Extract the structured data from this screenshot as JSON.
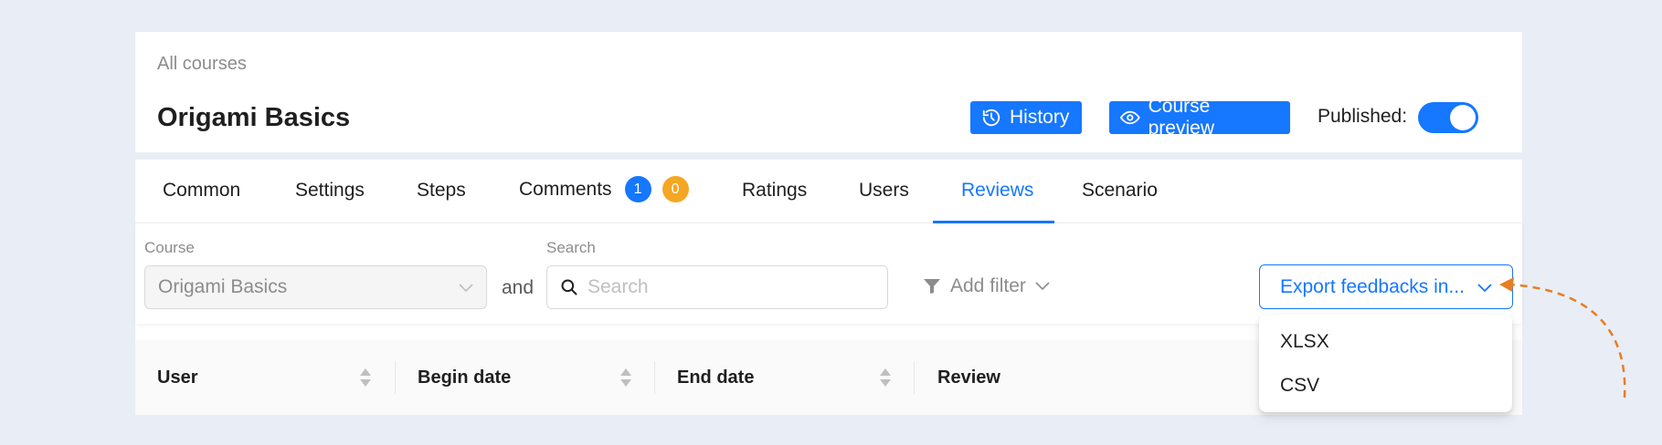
{
  "header": {
    "breadcrumb": "All courses",
    "title": "Origami Basics",
    "history_label": "History",
    "preview_label": "Course preview",
    "published_label": "Published",
    "published_separator": ":",
    "published_on": true
  },
  "tabs": [
    {
      "label": "Common"
    },
    {
      "label": "Settings"
    },
    {
      "label": "Steps"
    },
    {
      "label": "Comments",
      "badges": [
        "1",
        "0"
      ]
    },
    {
      "label": "Ratings"
    },
    {
      "label": "Users"
    },
    {
      "label": "Reviews",
      "active": true
    },
    {
      "label": "Scenario"
    }
  ],
  "filters": {
    "course_label": "Course",
    "course_value": "Origami Basics",
    "and_text": "and",
    "search_label": "Search",
    "search_placeholder": "Search",
    "add_filter_label": "Add filter",
    "export_label": "Export feedbacks in..."
  },
  "table": {
    "columns": [
      "User",
      "Begin date",
      "End date",
      "Review"
    ]
  },
  "export_menu": {
    "options": [
      "XLSX",
      "CSV"
    ]
  },
  "colors": {
    "accent": "#1677ff",
    "badge_orange": "#f5a623",
    "annotation_arrow": "#e67e22",
    "background": "#e9edf5"
  }
}
